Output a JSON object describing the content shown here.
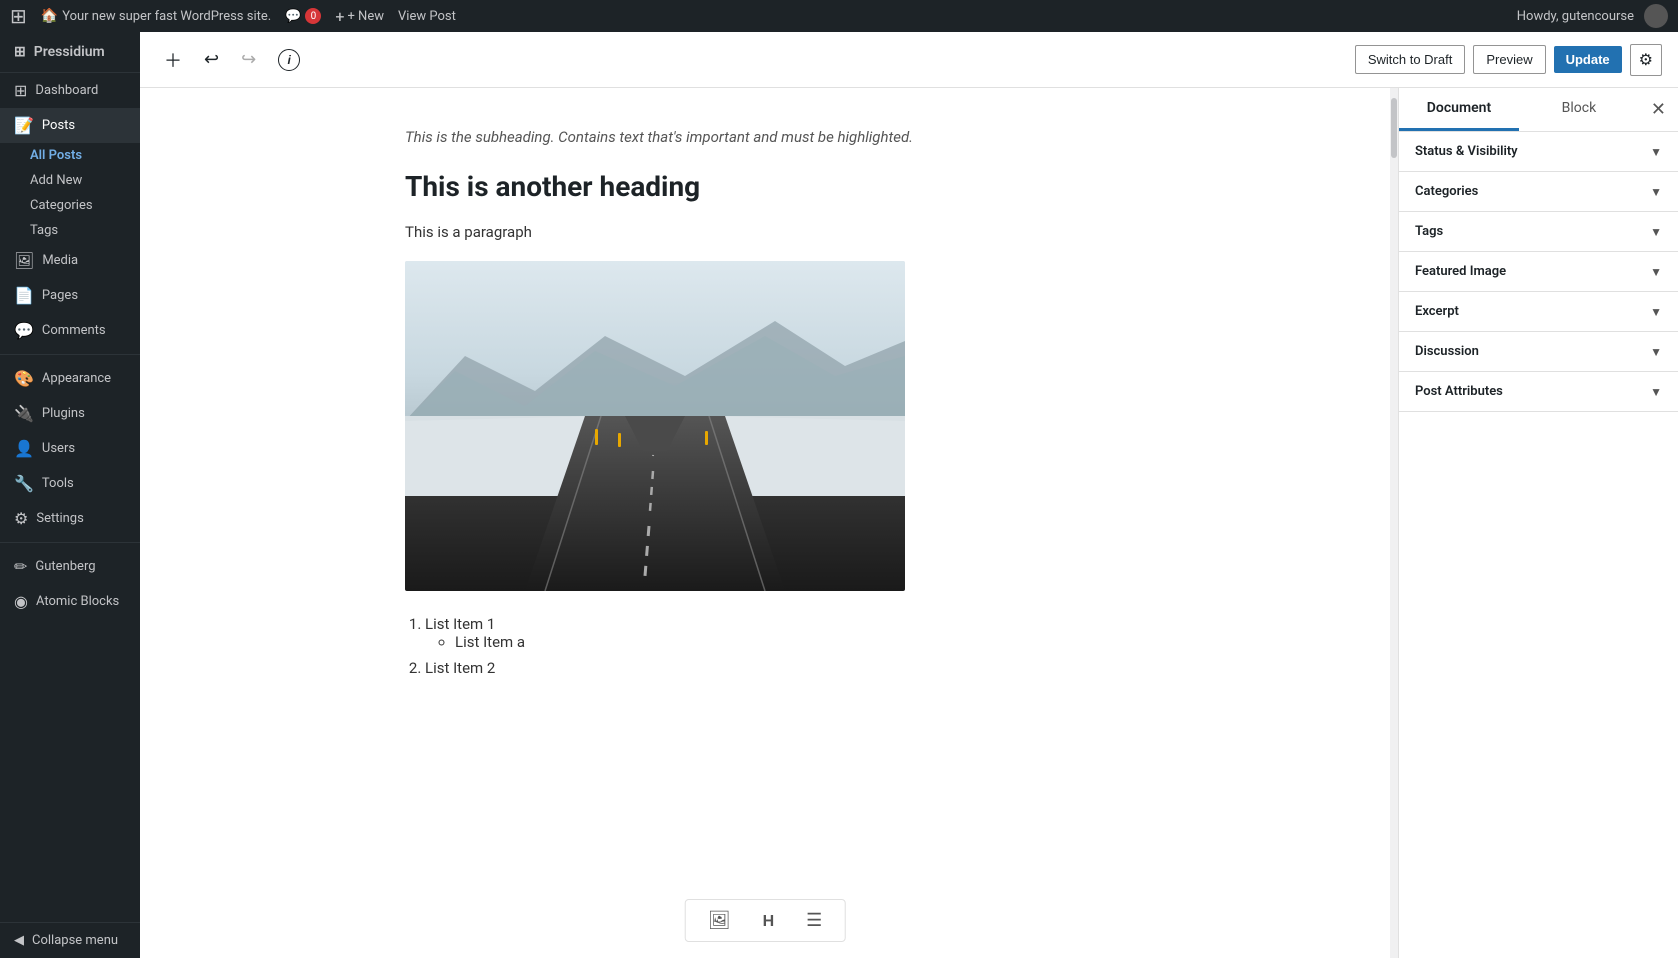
{
  "admin_bar": {
    "wp_icon": "⊞",
    "site_name": "Your new super fast WordPress site.",
    "comments_icon": "💬",
    "comments_count": "0",
    "new_label": "+ New",
    "view_post_label": "View Post",
    "howdy_label": "Howdy, gutencourse"
  },
  "sidebar": {
    "brand": "Pressidium",
    "items": [
      {
        "id": "dashboard",
        "icon": "⊞",
        "label": "Dashboard"
      },
      {
        "id": "posts",
        "icon": "📝",
        "label": "Posts",
        "active": true
      },
      {
        "id": "media",
        "icon": "🖼",
        "label": "Media"
      },
      {
        "id": "pages",
        "icon": "📄",
        "label": "Pages"
      },
      {
        "id": "comments",
        "icon": "💬",
        "label": "Comments"
      },
      {
        "id": "appearance",
        "icon": "🎨",
        "label": "Appearance"
      },
      {
        "id": "plugins",
        "icon": "🔌",
        "label": "Plugins"
      },
      {
        "id": "users",
        "icon": "👤",
        "label": "Users"
      },
      {
        "id": "tools",
        "icon": "🔧",
        "label": "Tools"
      },
      {
        "id": "settings",
        "icon": "⚙",
        "label": "Settings"
      },
      {
        "id": "gutenberg",
        "icon": "✏",
        "label": "Gutenberg"
      },
      {
        "id": "atomic-blocks",
        "icon": "◉",
        "label": "Atomic Blocks"
      }
    ],
    "posts_sub": [
      {
        "id": "all-posts",
        "label": "All Posts",
        "active": true
      },
      {
        "id": "add-new",
        "label": "Add New"
      },
      {
        "id": "categories",
        "label": "Categories"
      },
      {
        "id": "tags",
        "label": "Tags"
      }
    ],
    "collapse_label": "Collapse menu"
  },
  "toolbar": {
    "add_block_icon": "+",
    "undo_icon": "↩",
    "redo_icon": "↪",
    "info_icon": "ℹ",
    "switch_draft_label": "Switch to Draft",
    "preview_label": "Preview",
    "update_label": "Update",
    "settings_icon": "⚙"
  },
  "editor": {
    "subheading": "This is the subheading. Contains text that's important and must be highlighted.",
    "heading2": "This is another heading",
    "paragraph": "This is a paragraph",
    "image_alt": "Road through snowy landscape",
    "list_items": [
      {
        "text": "List Item 1",
        "sub": [
          "List Item a"
        ]
      },
      {
        "text": "List Item 2"
      }
    ]
  },
  "right_panel": {
    "tab_document": "Document",
    "tab_block": "Block",
    "sections": [
      {
        "id": "status-visibility",
        "label": "Status & Visibility"
      },
      {
        "id": "categories",
        "label": "Categories"
      },
      {
        "id": "tags",
        "label": "Tags"
      },
      {
        "id": "featured-image",
        "label": "Featured Image"
      },
      {
        "id": "excerpt",
        "label": "Excerpt"
      },
      {
        "id": "discussion",
        "label": "Discussion"
      },
      {
        "id": "post-attributes",
        "label": "Post Attributes"
      }
    ]
  },
  "block_tools": [
    "🖼",
    "H",
    "☰"
  ]
}
